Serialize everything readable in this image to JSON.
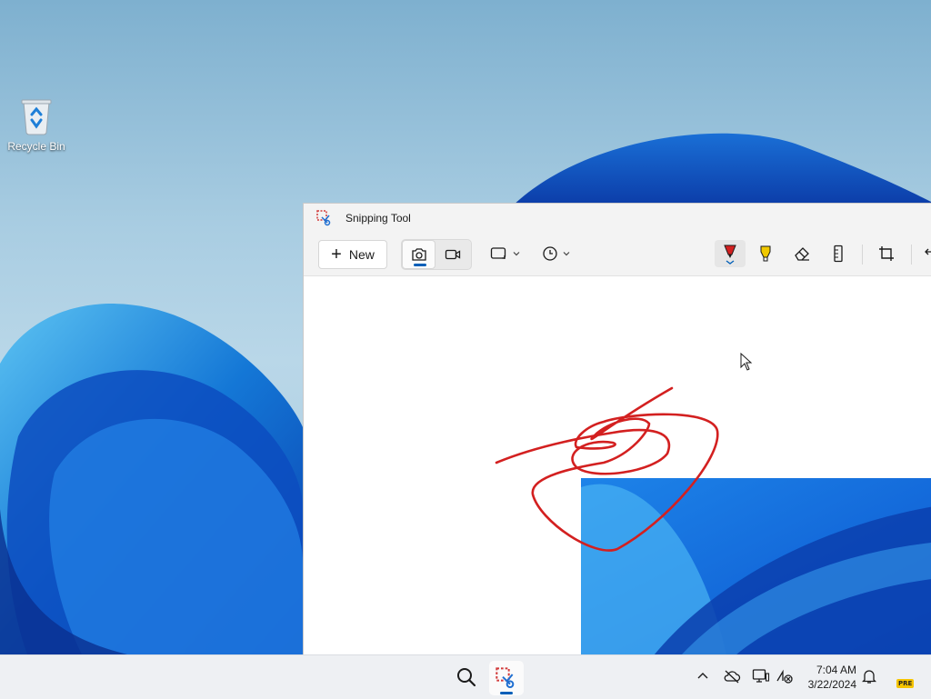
{
  "desktop": {
    "icons": [
      {
        "label": "Recycle Bin",
        "icon": "recycle-bin-icon"
      }
    ]
  },
  "window": {
    "title": "Snipping Tool",
    "icon": "snipping-tool-icon",
    "toolbar": {
      "new_label": "New",
      "modes": [
        {
          "name": "screenshot-mode",
          "icon": "camera-icon",
          "active": true
        },
        {
          "name": "video-mode",
          "icon": "video-camera-icon",
          "active": false
        }
      ],
      "snip_shape_icon": "rectangle-icon",
      "delay_icon": "clock-icon",
      "tools": [
        {
          "name": "ballpoint-pen",
          "icon": "pen-icon",
          "color": "#d32020",
          "selected": true
        },
        {
          "name": "highlighter",
          "icon": "highlighter-icon",
          "color": "#f0c800",
          "selected": false
        },
        {
          "name": "eraser",
          "icon": "eraser-icon",
          "selected": false
        },
        {
          "name": "ruler",
          "icon": "ruler-icon",
          "selected": false
        },
        {
          "name": "crop",
          "icon": "crop-icon",
          "selected": false
        }
      ]
    },
    "accent_color": "#005fb8",
    "ink_color": "#d32020"
  },
  "taskbar": {
    "icons": [
      "search-icon",
      "snipping-tool-icon"
    ],
    "tray": [
      "chevron-up-icon",
      "cloud-offline-icon",
      "display-icon",
      "network-icon",
      "bell-icon"
    ],
    "time": "7:04 AM",
    "date": "3/22/2024",
    "badge": "PRE"
  }
}
